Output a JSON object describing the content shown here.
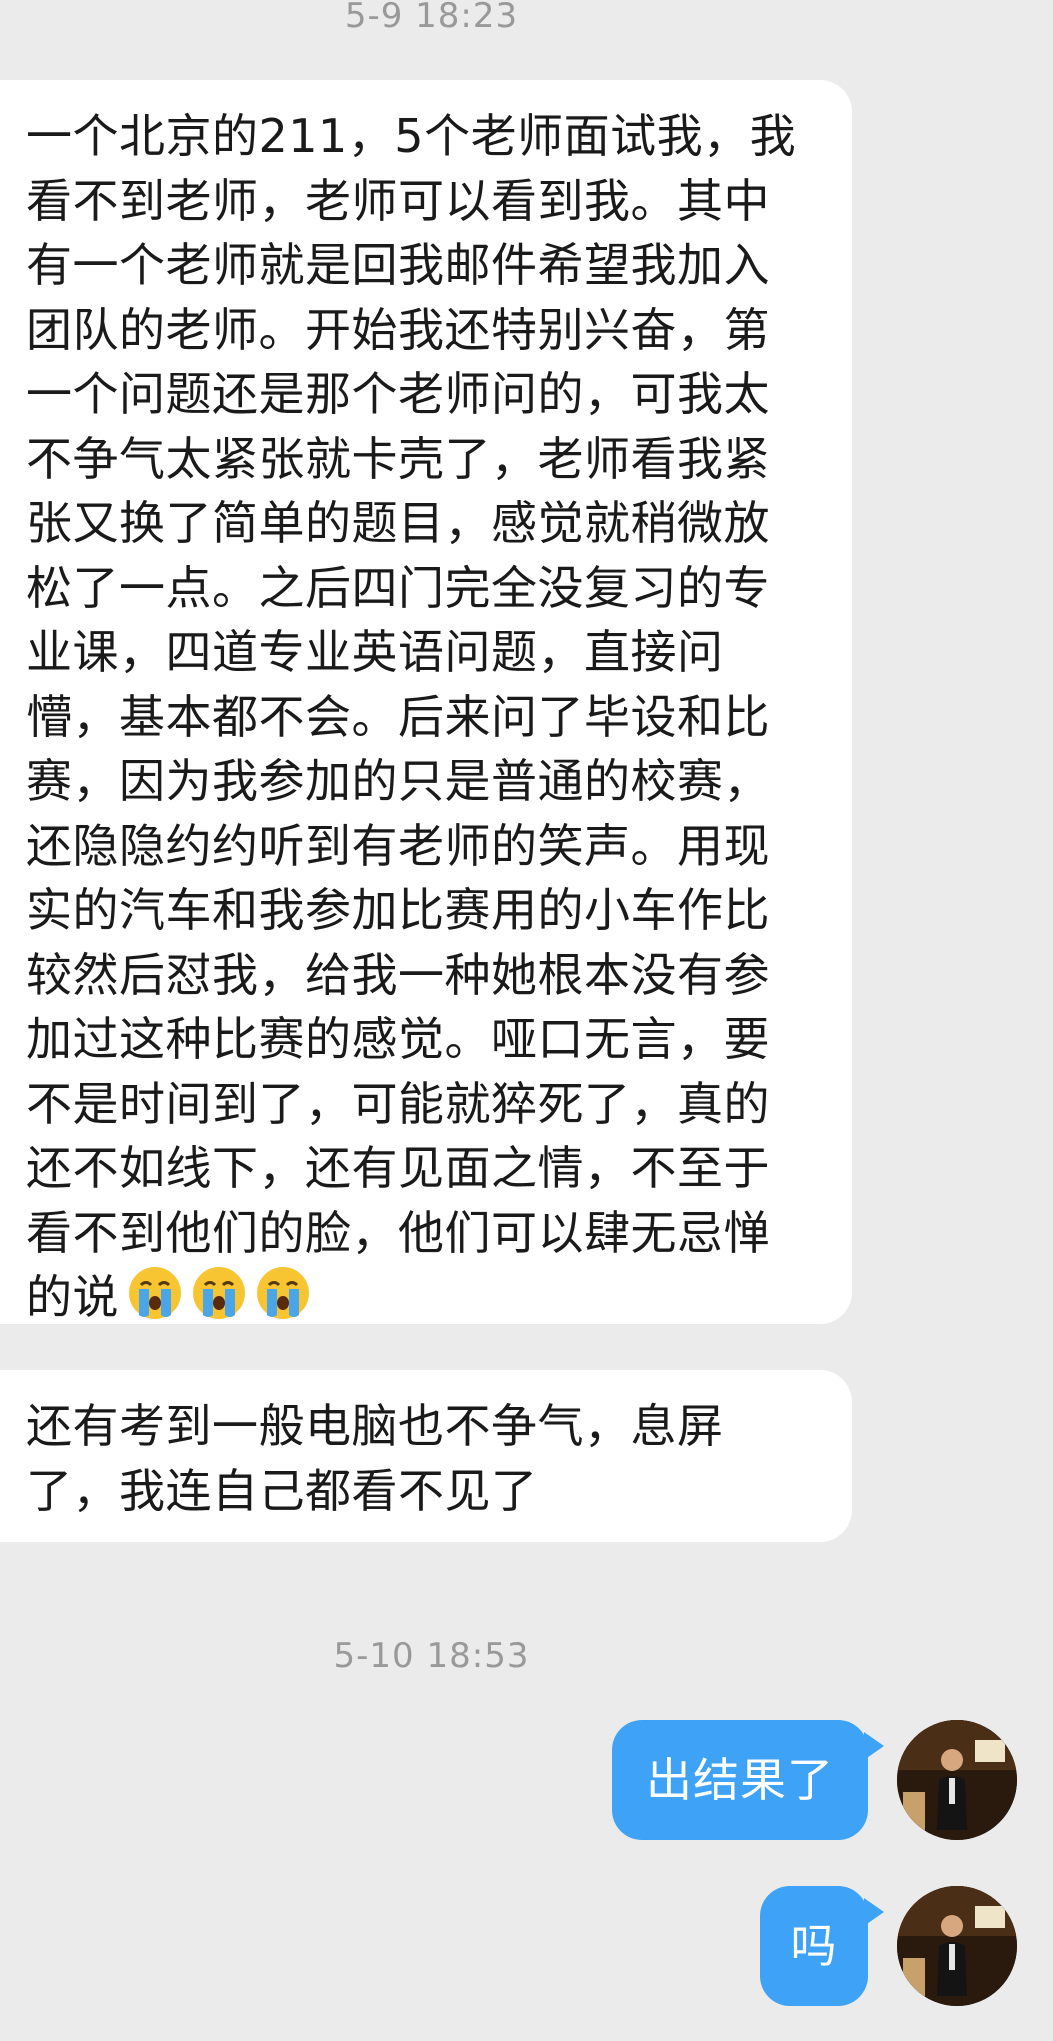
{
  "chat": {
    "timestamp_1": "5-9 18:23",
    "message_1": "一个北京的211，5个老师面试我，我\n看不到老师，老师可以看到我。其中\n有一个老师就是回我邮件希望我加入\n团队的老师。开始我还特别兴奋，第\n一个问题还是那个老师问的，可我太\n不争气太紧张就卡壳了，老师看我紧\n张又换了简单的题目，感觉就稍微放\n松了一点。之后四门完全没复习的专\n业课，四道专业英语问题，直接问\n懵，基本都不会。后来问了毕设和比\n赛，因为我参加的只是普通的校赛，\n还隐隐约约听到有老师的笑声。用现\n实的汽车和我参加比赛用的小车作比\n较然后怼我，给我一种她根本没有参\n加过这种比赛的感觉。哑口无言，要\n不是时间到了，可能就猝死了，真的\n还不如线下，还有见面之情，不至于\n看不到他们的脸，他们可以肆无忌惮\n的说",
    "message_1_emojis": [
      "crying-face-emoji",
      "crying-face-emoji",
      "crying-face-emoji"
    ],
    "message_2": "还有考到一般电脑也不争气，息屏\n了，我连自己都看不见了",
    "timestamp_2": "5-10 18:53",
    "message_3": "出结果了",
    "message_4": "吗"
  },
  "colors": {
    "background": "#ebebeb",
    "incoming_bubble": "#ffffff",
    "outgoing_bubble": "#3ea2f7",
    "timestamp_text": "#999999"
  },
  "icons": {
    "avatar": "user-avatar-photo"
  }
}
